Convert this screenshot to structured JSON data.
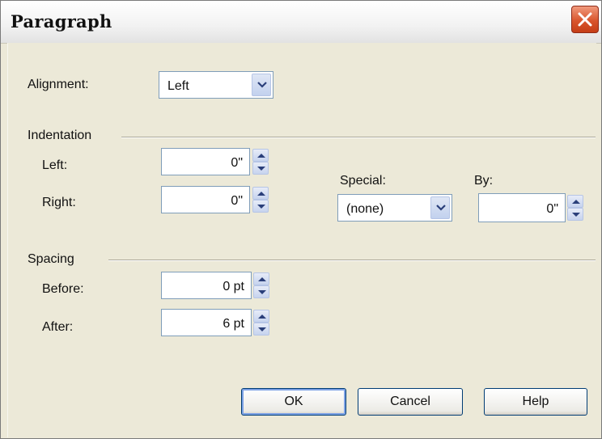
{
  "window": {
    "title": "Paragraph"
  },
  "alignment": {
    "label": "Alignment:",
    "value": "Left"
  },
  "indentation": {
    "header": "Indentation",
    "left": {
      "label": "Left:",
      "value": "0\""
    },
    "right": {
      "label": "Right:",
      "value": "0\""
    },
    "special": {
      "label": "Special:",
      "value": "(none)"
    },
    "by": {
      "label": "By:",
      "value": "0\""
    }
  },
  "spacing": {
    "header": "Spacing",
    "before": {
      "label": "Before:",
      "value": "0 pt"
    },
    "after": {
      "label": "After:",
      "value": "6 pt"
    }
  },
  "buttons": {
    "ok": "OK",
    "cancel": "Cancel",
    "help": "Help"
  },
  "colors": {
    "titlebar_close": "#d9562e",
    "field_border": "#7f9db9",
    "dialog_bg": "#ece9d8"
  }
}
